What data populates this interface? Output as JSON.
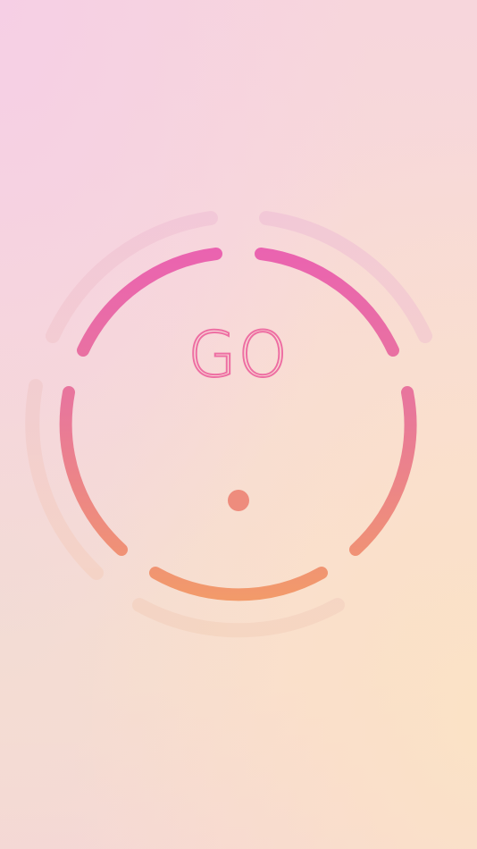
{
  "game": {
    "start_label": "GO",
    "colors": {
      "ring_top": "#ea63b0",
      "ring_bottom": "#f29a6a",
      "ball": "#ee8c7d",
      "go_text": "#ee6fa3",
      "ghost_ring": "#efc0cf"
    }
  }
}
